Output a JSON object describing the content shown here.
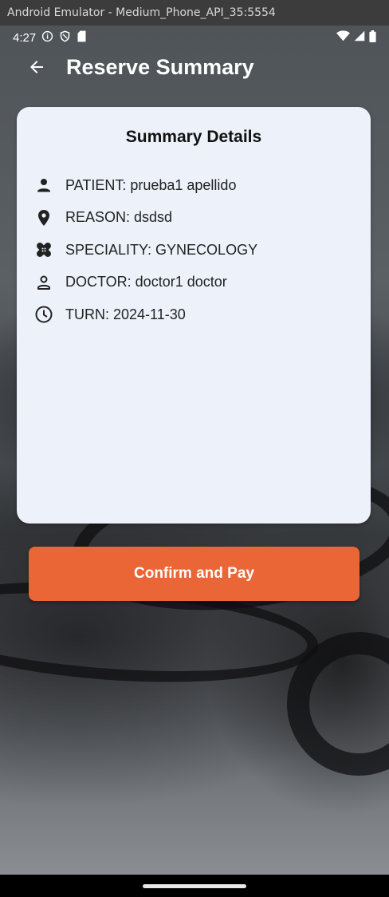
{
  "window": {
    "title": "Android Emulator - Medium_Phone_API_35:5554"
  },
  "status_bar": {
    "time": "4:27",
    "left_icons": [
      "info-icon",
      "shield-icon",
      "sd-card-icon"
    ],
    "right_icons": [
      "wifi-icon",
      "signal-icon",
      "battery-icon"
    ]
  },
  "app_bar": {
    "title": "Reserve Summary",
    "back_icon": "arrow-left-icon"
  },
  "card": {
    "title": "Summary Details",
    "items": [
      {
        "icon": "person-icon",
        "text": "PATIENT: prueba1 apellido"
      },
      {
        "icon": "location-pin-icon",
        "text": "REASON: dsdsd"
      },
      {
        "icon": "healing-icon",
        "text": "SPECIALITY: GYNECOLOGY"
      },
      {
        "icon": "person-outline-icon",
        "text": "DOCTOR: doctor1 doctor"
      },
      {
        "icon": "clock-icon",
        "text": "TURN: 2024-11-30"
      }
    ]
  },
  "actions": {
    "confirm_label": "Confirm and Pay"
  },
  "colors": {
    "accent": "#ea6637",
    "card_bg": "#edf1f9",
    "text": "#222222"
  }
}
